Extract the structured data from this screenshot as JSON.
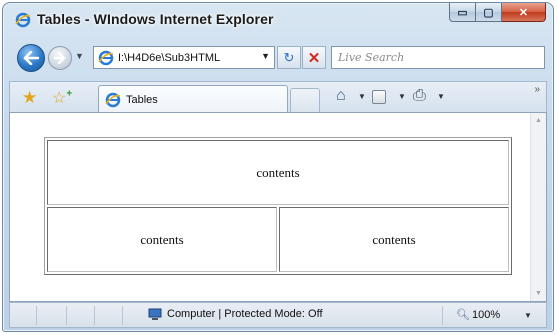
{
  "window": {
    "title": "Tables - WIndows Internet Explorer",
    "caption_buttons": {
      "minimize": "▭",
      "maximize": "▢",
      "close": "✕"
    }
  },
  "address_bar": {
    "url": "I:\\H4D6e\\Sub3HTML",
    "search_placeholder": "Live Search"
  },
  "tab": {
    "label": "Tables"
  },
  "toolbar": {
    "icons": [
      "favorites-star-icon",
      "add-favorites-icon",
      "home-icon",
      "feeds-icon",
      "print-icon"
    ],
    "chevron": "»"
  },
  "page": {
    "table": {
      "row1": [
        "contents"
      ],
      "row2": [
        "contents",
        "contents"
      ]
    }
  },
  "status_bar": {
    "zone": "Computer | Protected Mode: Off",
    "zoom": "100%"
  },
  "colors": {
    "accent": "#2d79c7",
    "close_button": "#c0391d",
    "chrome": "#c6d9ec"
  }
}
